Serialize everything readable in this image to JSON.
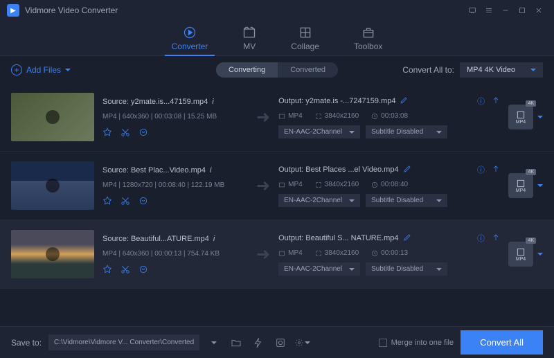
{
  "app": {
    "title": "Vidmore Video Converter"
  },
  "nav": {
    "converter": "Converter",
    "mv": "MV",
    "collage": "Collage",
    "toolbox": "Toolbox"
  },
  "subbar": {
    "add_files": "Add Files",
    "converting": "Converting",
    "converted": "Converted",
    "convert_all_to": "Convert All to:",
    "convert_all_fmt": "MP4 4K Video"
  },
  "rows": [
    {
      "source_label": "Source: y2mate.is...47159.mp4",
      "meta": "MP4 | 640x360 | 00:03:08 | 15.25 MB",
      "output_label": "Output: y2mate.is -...7247159.mp4",
      "out_fmt": "MP4",
      "out_res": "3840x2160",
      "out_dur": "00:03:08",
      "audio": "EN-AAC-2Channel",
      "subtitle": "Subtitle Disabled",
      "badge": "4K",
      "fmt_label": "MP4"
    },
    {
      "source_label": "Source: Best Plac...Video.mp4",
      "meta": "MP4 | 1280x720 | 00:08:40 | 122.19 MB",
      "output_label": "Output: Best Places ...el Video.mp4",
      "out_fmt": "MP4",
      "out_res": "3840x2160",
      "out_dur": "00:08:40",
      "audio": "EN-AAC-2Channel",
      "subtitle": "Subtitle Disabled",
      "badge": "4K",
      "fmt_label": "MP4"
    },
    {
      "source_label": "Source: Beautiful...ATURE.mp4",
      "meta": "MP4 | 640x360 | 00:00:13 | 754.74 KB",
      "output_label": "Output: Beautiful S... NATURE.mp4",
      "out_fmt": "MP4",
      "out_res": "3840x2160",
      "out_dur": "00:00:13",
      "audio": "EN-AAC-2Channel",
      "subtitle": "Subtitle Disabled",
      "badge": "4K",
      "fmt_label": "MP4"
    }
  ],
  "footer": {
    "save_to": "Save to:",
    "path": "C:\\Vidmore\\Vidmore V... Converter\\Converted",
    "merge": "Merge into one file",
    "convert_all": "Convert All"
  }
}
